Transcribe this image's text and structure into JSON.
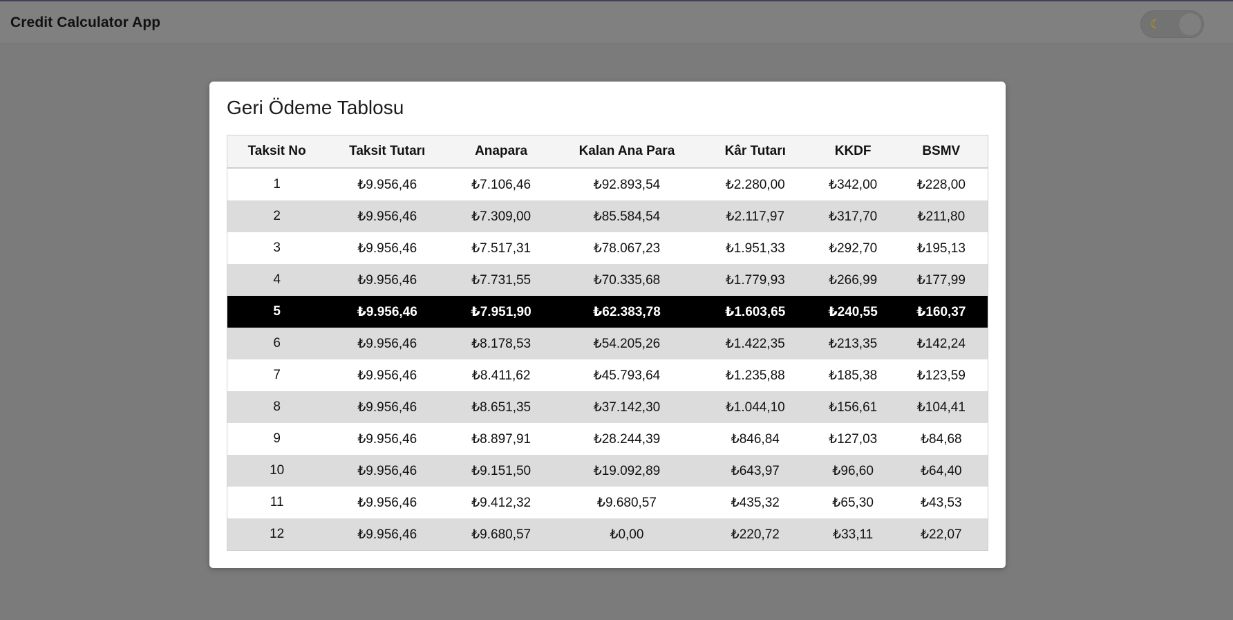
{
  "app": {
    "title": "Credit Calculator App",
    "theme_toggle_icon": "moon-icon"
  },
  "modal": {
    "title": "Geri Ödeme Tablosu"
  },
  "table": {
    "columns": [
      "Taksit No",
      "Taksit Tutarı",
      "Anapara",
      "Kalan Ana Para",
      "Kâr Tutarı",
      "KKDF",
      "BSMV"
    ],
    "highlighted_row": 5,
    "rows": [
      [
        "1",
        "₺9.956,46",
        "₺7.106,46",
        "₺92.893,54",
        "₺2.280,00",
        "₺342,00",
        "₺228,00"
      ],
      [
        "2",
        "₺9.956,46",
        "₺7.309,00",
        "₺85.584,54",
        "₺2.117,97",
        "₺317,70",
        "₺211,80"
      ],
      [
        "3",
        "₺9.956,46",
        "₺7.517,31",
        "₺78.067,23",
        "₺1.951,33",
        "₺292,70",
        "₺195,13"
      ],
      [
        "4",
        "₺9.956,46",
        "₺7.731,55",
        "₺70.335,68",
        "₺1.779,93",
        "₺266,99",
        "₺177,99"
      ],
      [
        "5",
        "₺9.956,46",
        "₺7.951,90",
        "₺62.383,78",
        "₺1.603,65",
        "₺240,55",
        "₺160,37"
      ],
      [
        "6",
        "₺9.956,46",
        "₺8.178,53",
        "₺54.205,26",
        "₺1.422,35",
        "₺213,35",
        "₺142,24"
      ],
      [
        "7",
        "₺9.956,46",
        "₺8.411,62",
        "₺45.793,64",
        "₺1.235,88",
        "₺185,38",
        "₺123,59"
      ],
      [
        "8",
        "₺9.956,46",
        "₺8.651,35",
        "₺37.142,30",
        "₺1.044,10",
        "₺156,61",
        "₺104,41"
      ],
      [
        "9",
        "₺9.956,46",
        "₺8.897,91",
        "₺28.244,39",
        "₺846,84",
        "₺127,03",
        "₺84,68"
      ],
      [
        "10",
        "₺9.956,46",
        "₺9.151,50",
        "₺19.092,89",
        "₺643,97",
        "₺96,60",
        "₺64,40"
      ],
      [
        "11",
        "₺9.956,46",
        "₺9.412,32",
        "₺9.680,57",
        "₺435,32",
        "₺65,30",
        "₺43,53"
      ],
      [
        "12",
        "₺9.956,46",
        "₺9.680,57",
        "₺0,00",
        "₺220,72",
        "₺33,11",
        "₺22,07"
      ]
    ]
  }
}
